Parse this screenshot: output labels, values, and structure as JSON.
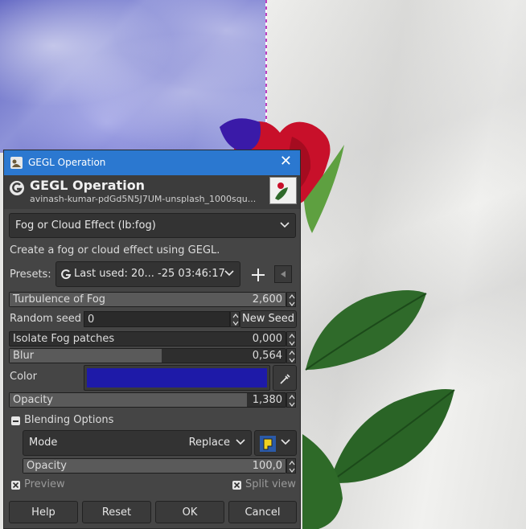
{
  "window": {
    "title": "GEGL Operation"
  },
  "header": {
    "title": "GEGL Operation",
    "subtitle": "avinash-kumar-pdGd5N5J7UM-unsplash_1000squ..."
  },
  "operation": {
    "selected": "Fog or Cloud Effect (lb:fog)",
    "description": "Create a fog or cloud effect using GEGL."
  },
  "presets": {
    "label": "Presets:",
    "value": "Last used: 20... -25 03:46:17"
  },
  "params": {
    "turbulence": {
      "label": "Turbulence of Fog",
      "value": "2,600",
      "fill": 1.0
    },
    "seed": {
      "label": "Random seed",
      "value": "0",
      "new_seed_label": "New Seed"
    },
    "isolate": {
      "label": "Isolate Fog patches",
      "value": "0,000",
      "fill": 0.0
    },
    "blur": {
      "label": "Blur",
      "value": "0,564",
      "fill": 0.55
    },
    "color": {
      "label": "Color",
      "value": "#1e1aa8"
    },
    "opacity": {
      "label": "Opacity",
      "value": "1,380",
      "fill": 0.86
    }
  },
  "blending": {
    "title": "Blending Options",
    "mode_label": "Mode",
    "mode_value": "Replace",
    "opacity_label": "Opacity",
    "opacity_value": "100,0",
    "opacity_fill": 1.0
  },
  "options": {
    "preview": "Preview",
    "split_view": "Split view"
  },
  "buttons": {
    "help": "Help",
    "reset": "Reset",
    "ok": "OK",
    "cancel": "Cancel"
  },
  "colors": {
    "titlebar": "#2b78d0",
    "dialog_bg": "#454545",
    "fog_color": "#1e1aa8"
  }
}
